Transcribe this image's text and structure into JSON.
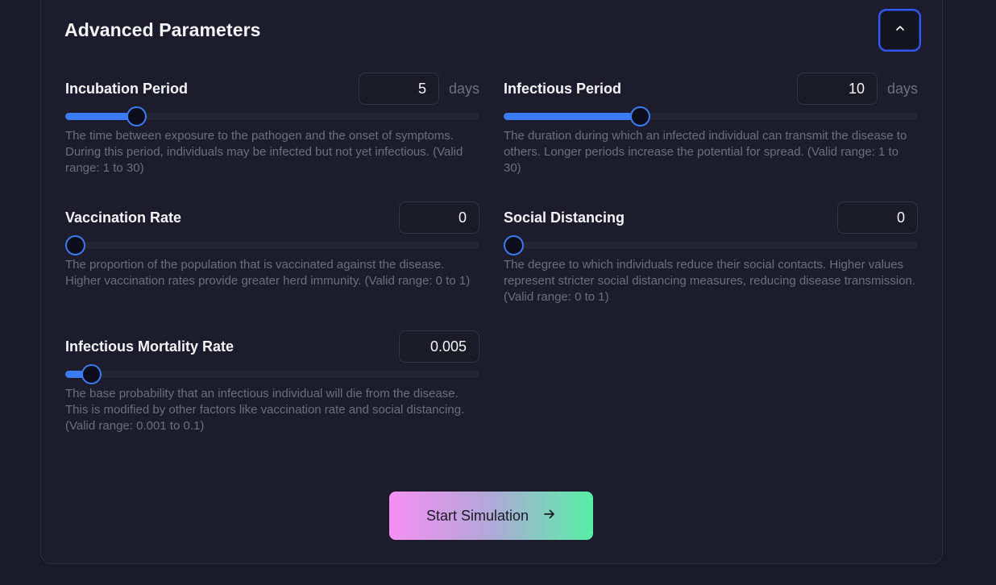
{
  "section": {
    "title": "Advanced Parameters",
    "collapse_icon": "chevron-up-icon"
  },
  "params": [
    {
      "label": "Incubation Period",
      "value": "5",
      "unit": "days",
      "slider_fraction": 0.155,
      "description": "The time between exposure to the pathogen and the onset of symptoms. During this period, individuals may be infected but not yet infectious. (Valid range: 1 to 30)"
    },
    {
      "label": "Infectious Period",
      "value": "10",
      "unit": "days",
      "slider_fraction": 0.32,
      "description": "The duration during which an infected individual can transmit the disease to others. Longer periods increase the potential for spread. (Valid range: 1 to 30)"
    },
    {
      "label": "Vaccination Rate",
      "value": "0",
      "slider_fraction": 0.0,
      "description": "The proportion of the population that is vaccinated against the disease. Higher vaccination rates provide greater herd immunity. (Valid range: 0 to 1)"
    },
    {
      "label": "Social Distancing",
      "value": "0",
      "slider_fraction": 0.0,
      "description": "The degree to which individuals reduce their social contacts. Higher values represent stricter social distancing measures, reducing disease transmission. (Valid range: 0 to 1)"
    },
    {
      "label": "Infectious Mortality Rate",
      "value": "0.005",
      "slider_fraction": 0.04,
      "description": "The base probability that an infectious individual will die from the disease. This is modified by other factors like vaccination rate and social distancing. (Valid range: 0.001 to 0.1)"
    }
  ],
  "start_button": {
    "label": "Start Simulation",
    "icon": "arrow-right-icon"
  },
  "colors": {
    "accent": "#3a7af2",
    "focus_ring": "#2f5bff",
    "gradient_start": "#f68ff2",
    "gradient_end": "#57f0a6"
  }
}
